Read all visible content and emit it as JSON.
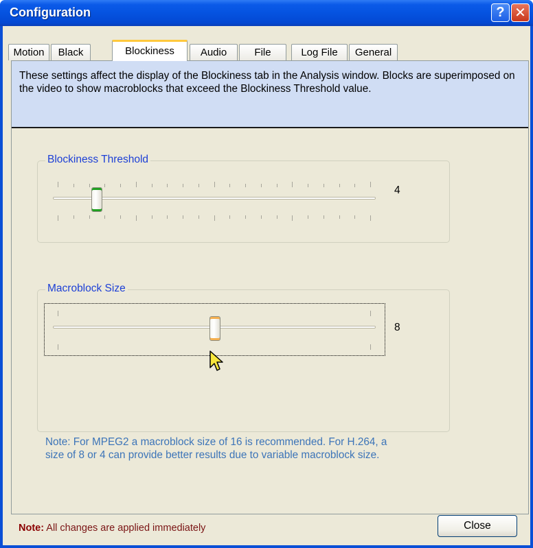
{
  "window": {
    "title": "Configuration"
  },
  "titlebar_buttons": {
    "help": "?",
    "close": "✕"
  },
  "tabs": [
    {
      "label": "Motion",
      "active": false
    },
    {
      "label": "Black",
      "active": false
    },
    {
      "label": "Blockiness",
      "active": true
    },
    {
      "label": "Audio",
      "active": false
    },
    {
      "label": "File",
      "active": false
    },
    {
      "label": "Log File",
      "active": false
    },
    {
      "label": "General",
      "active": false
    }
  ],
  "description": "These settings affect the display of the Blockiness tab in the Analysis window. Blocks are superimposed on the video to show macroblocks that exceed the Blockiness Threshold value.",
  "blockiness_threshold": {
    "title": "Blockiness Threshold",
    "value": "4"
  },
  "macroblock_size": {
    "title": "Macroblock Size",
    "value": "8",
    "note": "Note: For MPEG2 a macroblock size of 16 is recommended. For H.264, a size of 8 or 4 can provide better results due to variable macroblock size."
  },
  "footer": {
    "note_label": "Note:",
    "note_text": " All changes are applied immediately",
    "close_label": "Close"
  },
  "colors": {
    "title_bar": "#0553e0",
    "group_title": "#1c3fd6",
    "note_text": "#3c74b8",
    "footer_note": "#8b0000",
    "desc_bg": "#d0ddf4"
  }
}
